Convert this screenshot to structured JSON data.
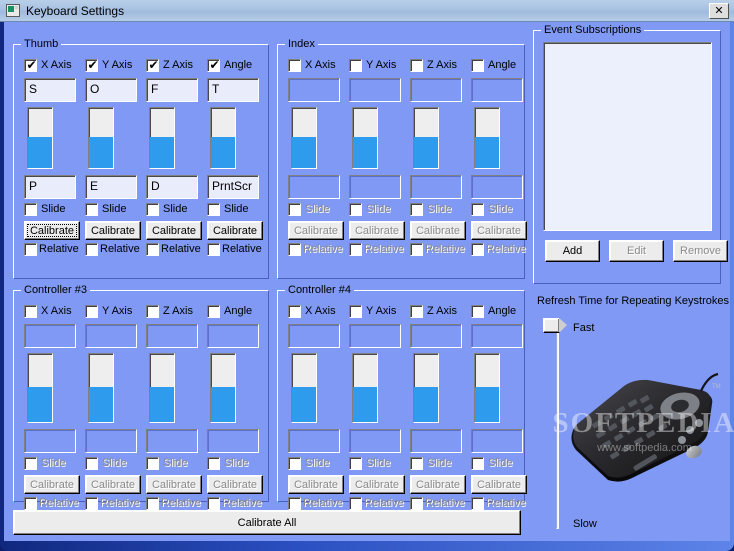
{
  "window": {
    "title": "Keyboard Settings",
    "icon": "monitor-icon",
    "close_label": "✕",
    "colors": {
      "client_bg": "#8099f5",
      "accent_bar": "#2e9bec",
      "field_bg": "#e8ecfb",
      "button_face": "#ececec",
      "disabled_text": "#8a8a8a"
    }
  },
  "axis_labels": [
    "X Axis",
    "Y Axis",
    "Z Axis",
    "Angle"
  ],
  "row_labels": {
    "slide": "Slide",
    "relative": "Relative",
    "calibrate": "Calibrate"
  },
  "groups": [
    {
      "title": "Thumb",
      "enabled": true,
      "axes": [
        {
          "label": "X Axis",
          "checked": true,
          "top_value": "S",
          "bottom_value": "P",
          "bar_fill_pct": 52,
          "slide": false,
          "relative": false,
          "calibrate": "Calibrate",
          "focused": true
        },
        {
          "label": "Y Axis",
          "checked": true,
          "top_value": "O",
          "bottom_value": "E",
          "bar_fill_pct": 52,
          "slide": false,
          "relative": false,
          "calibrate": "Calibrate",
          "focused": false
        },
        {
          "label": "Z Axis",
          "checked": true,
          "top_value": "F",
          "bottom_value": "D",
          "bar_fill_pct": 52,
          "slide": false,
          "relative": false,
          "calibrate": "Calibrate",
          "focused": false
        },
        {
          "label": "Angle",
          "checked": true,
          "top_value": "T",
          "bottom_value": "PrntScr",
          "bar_fill_pct": 52,
          "slide": false,
          "relative": false,
          "calibrate": "Calibrate",
          "focused": false
        }
      ]
    },
    {
      "title": "Index",
      "enabled": false,
      "axes": [
        {
          "label": "X Axis",
          "checked": false,
          "top_value": "",
          "bottom_value": "",
          "bar_fill_pct": 52,
          "slide": false,
          "relative": false,
          "calibrate": "Calibrate",
          "focused": false
        },
        {
          "label": "Y Axis",
          "checked": false,
          "top_value": "",
          "bottom_value": "",
          "bar_fill_pct": 52,
          "slide": false,
          "relative": false,
          "calibrate": "Calibrate",
          "focused": false
        },
        {
          "label": "Z Axis",
          "checked": false,
          "top_value": "",
          "bottom_value": "",
          "bar_fill_pct": 52,
          "slide": false,
          "relative": false,
          "calibrate": "Calibrate",
          "focused": false
        },
        {
          "label": "Angle",
          "checked": false,
          "top_value": "",
          "bottom_value": "",
          "bar_fill_pct": 52,
          "slide": false,
          "relative": false,
          "calibrate": "Calibrate",
          "focused": false
        }
      ]
    },
    {
      "title": "Controller #3",
      "enabled": false,
      "axes": [
        {
          "label": "X Axis",
          "checked": false,
          "top_value": "",
          "bottom_value": "",
          "bar_fill_pct": 52,
          "slide": false,
          "relative": false,
          "calibrate": "Calibrate",
          "focused": false
        },
        {
          "label": "Y Axis",
          "checked": false,
          "top_value": "",
          "bottom_value": "",
          "bar_fill_pct": 52,
          "slide": false,
          "relative": false,
          "calibrate": "Calibrate",
          "focused": false
        },
        {
          "label": "Z Axis",
          "checked": false,
          "top_value": "",
          "bottom_value": "",
          "bar_fill_pct": 52,
          "slide": false,
          "relative": false,
          "calibrate": "Calibrate",
          "focused": false
        },
        {
          "label": "Angle",
          "checked": false,
          "top_value": "",
          "bottom_value": "",
          "bar_fill_pct": 52,
          "slide": false,
          "relative": false,
          "calibrate": "Calibrate",
          "focused": false
        }
      ]
    },
    {
      "title": "Controller #4",
      "enabled": false,
      "axes": [
        {
          "label": "X Axis",
          "checked": false,
          "top_value": "",
          "bottom_value": "",
          "bar_fill_pct": 52,
          "slide": false,
          "relative": false,
          "calibrate": "Calibrate",
          "focused": false
        },
        {
          "label": "Y Axis",
          "checked": false,
          "top_value": "",
          "bottom_value": "",
          "bar_fill_pct": 52,
          "slide": false,
          "relative": false,
          "calibrate": "Calibrate",
          "focused": false
        },
        {
          "label": "Z Axis",
          "checked": false,
          "top_value": "",
          "bottom_value": "",
          "bar_fill_pct": 52,
          "slide": false,
          "relative": false,
          "calibrate": "Calibrate",
          "focused": false
        },
        {
          "label": "Angle",
          "checked": false,
          "top_value": "",
          "bottom_value": "",
          "bar_fill_pct": 52,
          "slide": false,
          "relative": false,
          "calibrate": "Calibrate",
          "focused": false
        }
      ]
    }
  ],
  "calibrate_all": {
    "label": "Calibrate All"
  },
  "events": {
    "title": "Event Subscriptions",
    "items": [],
    "buttons": [
      {
        "label": "Add",
        "enabled": true
      },
      {
        "label": "Edit",
        "enabled": false
      },
      {
        "label": "Remove",
        "enabled": false
      }
    ]
  },
  "refresh": {
    "title": "Refresh Time for Repeating Keystrokes",
    "fast_label": "Fast",
    "slow_label": "Slow",
    "thumb_position_pct": 0
  },
  "product_image": {
    "alt": "black-keyboard-photo",
    "watermark_line1": "SOFTPEDIA",
    "watermark_line2": "www.softpedia.com"
  }
}
